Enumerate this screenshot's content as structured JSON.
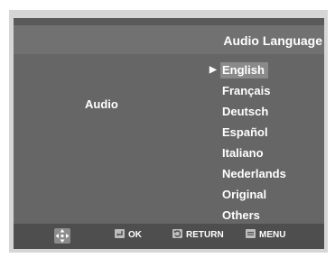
{
  "header": {
    "title": "Audio Language"
  },
  "setting": {
    "label": "Audio"
  },
  "options": [
    {
      "label": "English",
      "selected": true
    },
    {
      "label": "Français",
      "selected": false
    },
    {
      "label": "Deutsch",
      "selected": false
    },
    {
      "label": "Español",
      "selected": false
    },
    {
      "label": "Italiano",
      "selected": false
    },
    {
      "label": "Nederlands",
      "selected": false
    },
    {
      "label": "Original",
      "selected": false
    },
    {
      "label": "Others",
      "selected": false
    }
  ],
  "footer": {
    "ok_label": "OK",
    "return_label": "RETURN",
    "menu_label": "MENU",
    "icons": [
      "direction-pad-icon",
      "enter-icon",
      "return-icon",
      "menu-icon"
    ]
  },
  "colors": {
    "frame": "#d6d6d6",
    "background": "#666666",
    "header": "#717171",
    "footer": "#4e4e4e",
    "selection_highlight": "#8a8a8a",
    "text": "#ffffff"
  }
}
